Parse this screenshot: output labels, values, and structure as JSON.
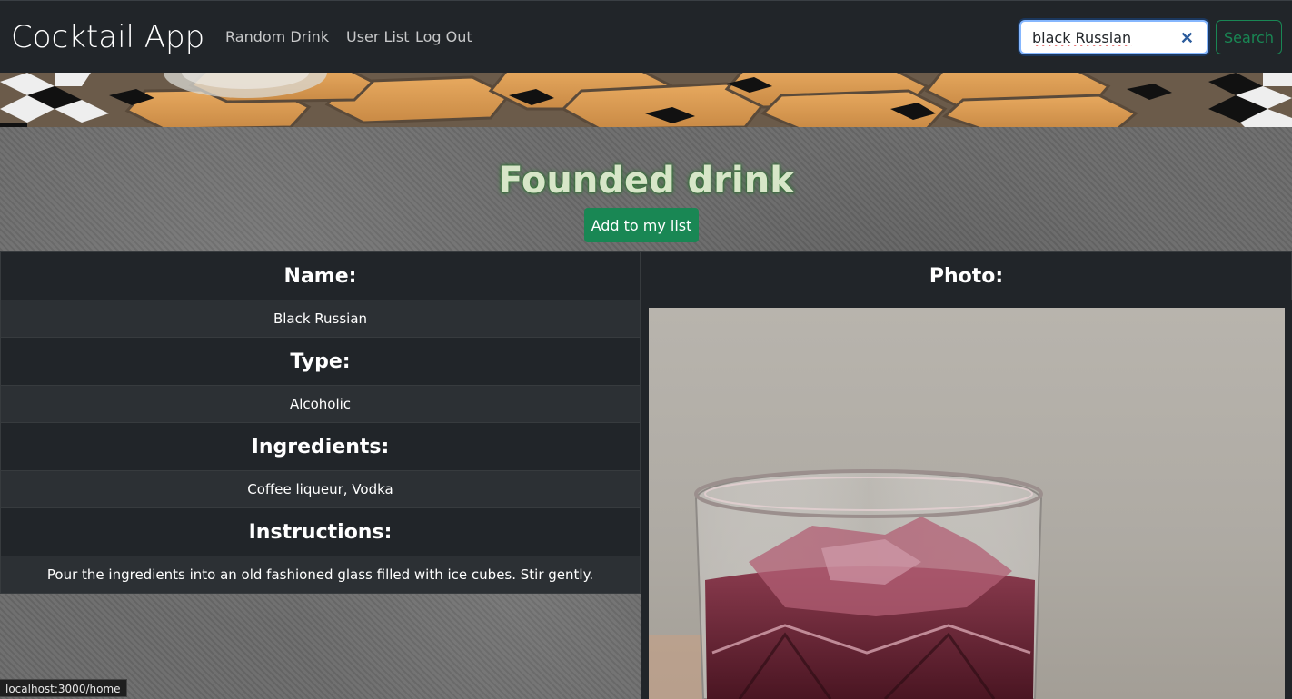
{
  "navbar": {
    "brand": "Cocktail App",
    "links": [
      {
        "label": "Random Drink"
      },
      {
        "label": "User List"
      },
      {
        "label": "Log Out"
      }
    ],
    "search": {
      "value": "black Russian",
      "button_label": "Search"
    }
  },
  "main": {
    "title": "Founded drink",
    "add_button_label": "Add to my list",
    "details": [
      {
        "heading": "Name:",
        "value": "Black Russian"
      },
      {
        "heading": "Type:",
        "value": "Alcoholic"
      },
      {
        "heading": "Ingredients:",
        "value": "Coffee liqueur, Vodka"
      },
      {
        "heading": "Instructions:",
        "value": "Pour the ingredients into an old fashioned glass filled with ice cubes. Stir gently."
      }
    ],
    "photo_heading": "Photo:"
  },
  "status_bar": {
    "url": "localhost:3000/home"
  },
  "colors": {
    "navbar_bg": "#212529",
    "success": "#198754",
    "table_dark": "#212529",
    "table_stripe": "#2c3034"
  },
  "icons": {
    "clear": "close-icon"
  }
}
